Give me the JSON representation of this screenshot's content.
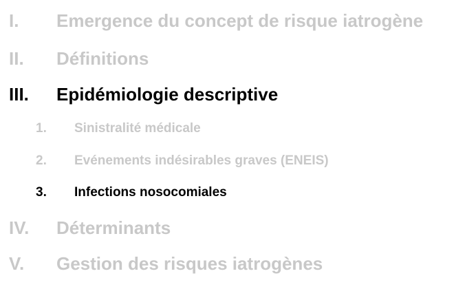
{
  "outline": {
    "sections": [
      {
        "number": "I.",
        "title": "Emergence du concept de risque iatrogène"
      },
      {
        "number": "II.",
        "title": "Définitions"
      },
      {
        "number": "III.",
        "title": "Epidémiologie descriptive"
      },
      {
        "number": "IV.",
        "title": "Déterminants"
      },
      {
        "number": "V.",
        "title": "Gestion des risques iatrogènes"
      }
    ],
    "subsections": [
      {
        "number": "1.",
        "title": "Sinistralité médicale"
      },
      {
        "number": "2.",
        "title": "Evénements indésirables graves (ENEIS)"
      },
      {
        "number": "3.",
        "title": "Infections nosocomiales"
      }
    ]
  },
  "colors": {
    "active": "#000000",
    "muted": "#c8c8c8"
  }
}
